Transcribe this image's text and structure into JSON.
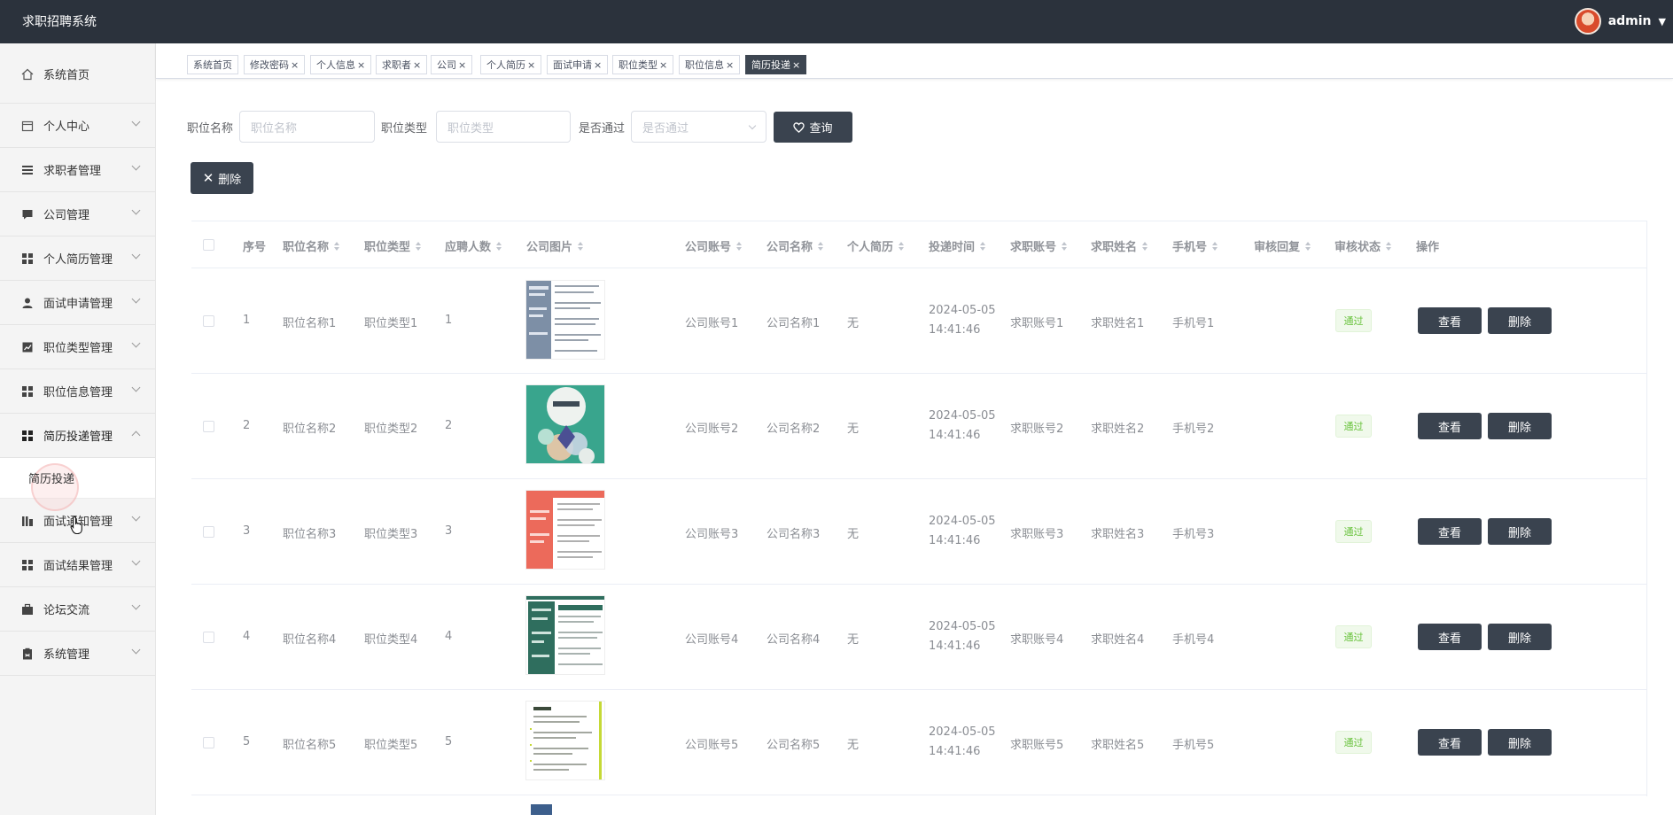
{
  "app": {
    "title": "求职招聘系统"
  },
  "user": {
    "name": "admin"
  },
  "sidebar": {
    "items": [
      {
        "label": "系统首页",
        "icon": "home-icon"
      },
      {
        "label": "个人中心",
        "icon": "calendar-icon"
      },
      {
        "label": "求职者管理",
        "icon": "list-icon"
      },
      {
        "label": "公司管理",
        "icon": "chat-icon"
      },
      {
        "label": "个人简历管理",
        "icon": "grid-icon"
      },
      {
        "label": "面试申请管理",
        "icon": "person-icon"
      },
      {
        "label": "职位类型管理",
        "icon": "chart-icon"
      },
      {
        "label": "职位信息管理",
        "icon": "grid-icon"
      },
      {
        "label": "简历投递管理",
        "icon": "grid-icon"
      },
      {
        "label": "面试通知管理",
        "icon": "bar-chart-icon"
      },
      {
        "label": "面试结果管理",
        "icon": "grid-icon"
      },
      {
        "label": "论坛交流",
        "icon": "briefcase-icon"
      },
      {
        "label": "系统管理",
        "icon": "clipboard-icon"
      }
    ],
    "sub_item": "简历投递"
  },
  "tabs": [
    "系统首页",
    "修改密码",
    "个人信息",
    "求职者",
    "公司",
    "个人简历",
    "面试申请",
    "职位类型",
    "职位信息",
    "简历投递"
  ],
  "search": {
    "job_name_label": "职位名称",
    "job_name_placeholder": "职位名称",
    "job_type_label": "职位类型",
    "job_type_placeholder": "职位类型",
    "passed_label": "是否通过",
    "passed_placeholder": "是否通过",
    "query_button": "查询"
  },
  "toolbar": {
    "delete_button": "删除"
  },
  "table": {
    "headers": [
      "序号",
      "职位名称",
      "职位类型",
      "应聘人数",
      "公司图片",
      "公司账号",
      "公司名称",
      "个人简历",
      "投递时间",
      "求职账号",
      "求职姓名",
      "手机号",
      "审核回复",
      "审核状态",
      "操作"
    ],
    "rows": [
      {
        "no": "1",
        "job_name": "职位名称1",
        "job_type": "职位类型1",
        "applicants": "1",
        "company_account": "公司账号1",
        "company_name": "公司名称1",
        "resume": "无",
        "date": "2024-05-05",
        "time": "14:41:46",
        "seeker_account": "求职账号1",
        "seeker_name": "求职姓名1",
        "phone": "手机号1",
        "reply": "",
        "status": "通过",
        "view": "查看",
        "delete": "删除"
      },
      {
        "no": "2",
        "job_name": "职位名称2",
        "job_type": "职位类型2",
        "applicants": "2",
        "company_account": "公司账号2",
        "company_name": "公司名称2",
        "resume": "无",
        "date": "2024-05-05",
        "time": "14:41:46",
        "seeker_account": "求职账号2",
        "seeker_name": "求职姓名2",
        "phone": "手机号2",
        "reply": "",
        "status": "通过",
        "view": "查看",
        "delete": "删除"
      },
      {
        "no": "3",
        "job_name": "职位名称3",
        "job_type": "职位类型3",
        "applicants": "3",
        "company_account": "公司账号3",
        "company_name": "公司名称3",
        "resume": "无",
        "date": "2024-05-05",
        "time": "14:41:46",
        "seeker_account": "求职账号3",
        "seeker_name": "求职姓名3",
        "phone": "手机号3",
        "reply": "",
        "status": "通过",
        "view": "查看",
        "delete": "删除"
      },
      {
        "no": "4",
        "job_name": "职位名称4",
        "job_type": "职位类型4",
        "applicants": "4",
        "company_account": "公司账号4",
        "company_name": "公司名称4",
        "resume": "无",
        "date": "2024-05-05",
        "time": "14:41:46",
        "seeker_account": "求职账号4",
        "seeker_name": "求职姓名4",
        "phone": "手机号4",
        "reply": "",
        "status": "通过",
        "view": "查看",
        "delete": "删除"
      },
      {
        "no": "5",
        "job_name": "职位名称5",
        "job_type": "职位类型5",
        "applicants": "5",
        "company_account": "公司账号5",
        "company_name": "公司名称5",
        "resume": "无",
        "date": "2024-05-05",
        "time": "14:41:46",
        "seeker_account": "求职账号5",
        "seeker_name": "求职姓名5",
        "phone": "手机号5",
        "reply": "",
        "status": "通过",
        "view": "查看",
        "delete": "删除"
      }
    ]
  },
  "colors": {
    "topbar": "#2b323c",
    "button_dark": "#3a434f",
    "pass_tag": "#67c23a"
  }
}
